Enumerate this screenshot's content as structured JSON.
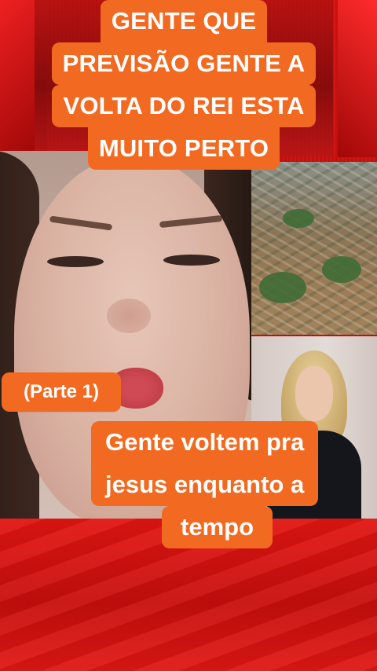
{
  "caption_top": {
    "lines": [
      "GENTE QUE",
      "PREVISÃO GENTE A",
      "VOLTA DO REI ESTA",
      "MUITO PERTO"
    ]
  },
  "caption_part": {
    "text": "(Parte  1)"
  },
  "caption_bottom": {
    "lines": [
      "Gente voltem pra",
      "jesus enquanto a",
      "tempo"
    ]
  },
  "colors": {
    "caption_bg": "#f26a21",
    "caption_text": "#ffffff",
    "background_red": "#c8100e"
  }
}
